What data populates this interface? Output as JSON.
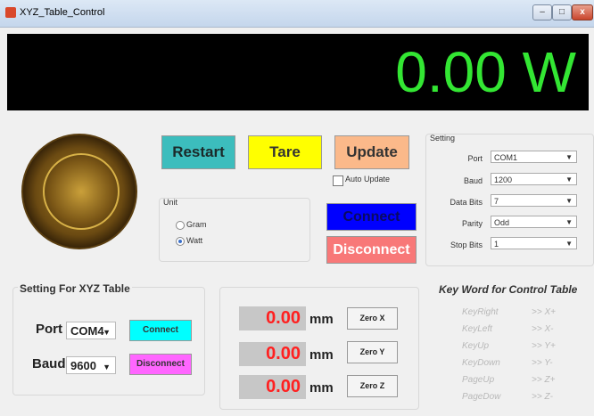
{
  "window": {
    "title": "XYZ_Table_Control",
    "min": "–",
    "max": "□",
    "close": "x"
  },
  "display": {
    "value": "0.00 W"
  },
  "buttons": {
    "restart": "Restart",
    "tare": "Tare",
    "update": "Update",
    "connect": "Connect",
    "disconnect": "Disconnect"
  },
  "auto_update": {
    "label": "Auto Update",
    "checked": false
  },
  "unit": {
    "title": "Unit",
    "options": [
      "Gram",
      "Watt"
    ],
    "selected": "Watt"
  },
  "setting": {
    "title": "Setting",
    "fields": [
      {
        "label": "Port",
        "value": "COM1"
      },
      {
        "label": "Baud",
        "value": "1200"
      },
      {
        "label": "Data Bits",
        "value": "7"
      },
      {
        "label": "Parity",
        "value": "Odd"
      },
      {
        "label": "Stop Bits",
        "value": "1"
      }
    ]
  },
  "xyz": {
    "title": "Setting For XYZ Table",
    "port_label": "Port",
    "port_value": "COM4",
    "baud_label": "Baud",
    "baud_value": "9600",
    "connect": "Connect",
    "disconnect": "Disconnect"
  },
  "positions": [
    {
      "value": "0.00",
      "unit": "mm",
      "zero": "Zero X"
    },
    {
      "value": "0.00",
      "unit": "mm",
      "zero": "Zero Y"
    },
    {
      "value": "0.00",
      "unit": "mm",
      "zero": "Zero Z"
    }
  ],
  "keywords": {
    "title": "Key Word  for Control Table",
    "items": [
      {
        "key": "KeyRight",
        "action": ">> X+"
      },
      {
        "key": "KeyLeft",
        "action": ">> X-"
      },
      {
        "key": "KeyUp",
        "action": ">> Y+"
      },
      {
        "key": "KeyDown",
        "action": ">> Y-"
      },
      {
        "key": "PageUp",
        "action": ">> Z+"
      },
      {
        "key": "PageDow",
        "action": ">> Z-"
      }
    ]
  },
  "colors": {
    "display_text": "#33e633",
    "restart": "#3cbdbd",
    "tare": "#ffff00",
    "update": "#fbb98a",
    "connect": "#0000ff",
    "disconnect": "#f87878",
    "mm_value": "#ff2020"
  }
}
